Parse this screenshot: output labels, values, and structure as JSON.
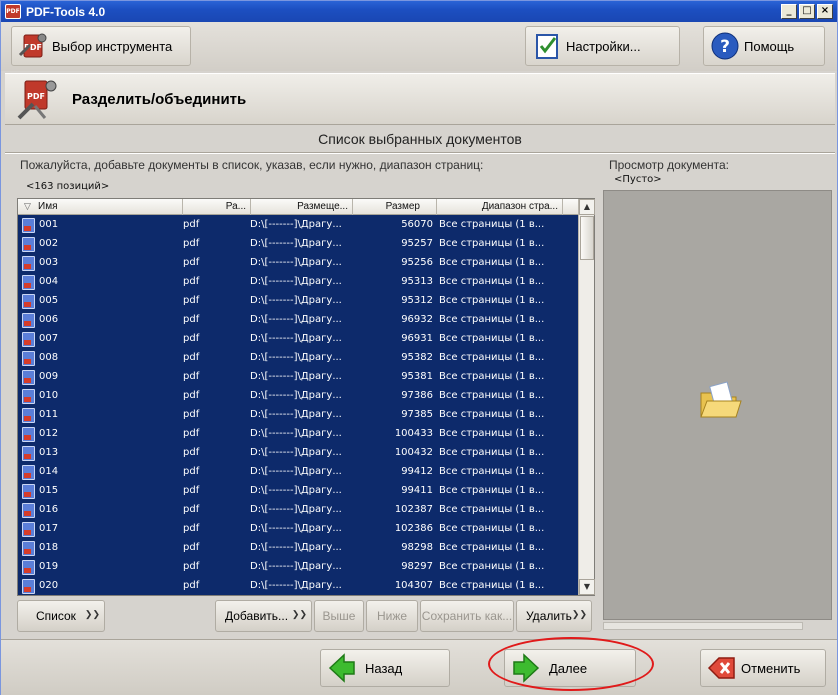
{
  "window": {
    "title": "PDF-Tools 4.0",
    "app_icon_label": "PDF",
    "controls": [
      "_",
      "□",
      "×"
    ]
  },
  "toolbar": {
    "select_tool_label": "Выбор инструмента",
    "settings_label": "Настройки...",
    "help_label": "Помощь",
    "select_tool_icon": "pdf-tools-icon",
    "settings_icon": "settings-checklist-icon",
    "help_icon": "help-question-icon"
  },
  "section": {
    "title": "Разделить/объединить",
    "icon": "split-merge-icon"
  },
  "list": {
    "caption": "Список выбранных документов",
    "hint": "Пожалуйста, добавьте документы в список, указав, если нужно, диапазон страниц:",
    "count": "<163 позиций>",
    "columns": [
      "Имя",
      "Ра...",
      "Размеще...",
      "Размер",
      "Диапазон стра..."
    ],
    "rows": [
      {
        "name": "001",
        "ext": "pdf",
        "location": "D:\\[-------]\\Драгу...",
        "size": "56070",
        "range": "Все страницы (1 в..."
      },
      {
        "name": "002",
        "ext": "pdf",
        "location": "D:\\[-------]\\Драгу...",
        "size": "95257",
        "range": "Все страницы (1 в..."
      },
      {
        "name": "003",
        "ext": "pdf",
        "location": "D:\\[-------]\\Драгу...",
        "size": "95256",
        "range": "Все страницы (1 в..."
      },
      {
        "name": "004",
        "ext": "pdf",
        "location": "D:\\[-------]\\Драгу...",
        "size": "95313",
        "range": "Все страницы (1 в..."
      },
      {
        "name": "005",
        "ext": "pdf",
        "location": "D:\\[-------]\\Драгу...",
        "size": "95312",
        "range": "Все страницы (1 в..."
      },
      {
        "name": "006",
        "ext": "pdf",
        "location": "D:\\[-------]\\Драгу...",
        "size": "96932",
        "range": "Все страницы (1 в..."
      },
      {
        "name": "007",
        "ext": "pdf",
        "location": "D:\\[-------]\\Драгу...",
        "size": "96931",
        "range": "Все страницы (1 в..."
      },
      {
        "name": "008",
        "ext": "pdf",
        "location": "D:\\[-------]\\Драгу...",
        "size": "95382",
        "range": "Все страницы (1 в..."
      },
      {
        "name": "009",
        "ext": "pdf",
        "location": "D:\\[-------]\\Драгу...",
        "size": "95381",
        "range": "Все страницы (1 в..."
      },
      {
        "name": "010",
        "ext": "pdf",
        "location": "D:\\[-------]\\Драгу...",
        "size": "97386",
        "range": "Все страницы (1 в..."
      },
      {
        "name": "011",
        "ext": "pdf",
        "location": "D:\\[-------]\\Драгу...",
        "size": "97385",
        "range": "Все страницы (1 в..."
      },
      {
        "name": "012",
        "ext": "pdf",
        "location": "D:\\[-------]\\Драгу...",
        "size": "100433",
        "range": "Все страницы (1 в..."
      },
      {
        "name": "013",
        "ext": "pdf",
        "location": "D:\\[-------]\\Драгу...",
        "size": "100432",
        "range": "Все страницы (1 в..."
      },
      {
        "name": "014",
        "ext": "pdf",
        "location": "D:\\[-------]\\Драгу...",
        "size": "99412",
        "range": "Все страницы (1 в..."
      },
      {
        "name": "015",
        "ext": "pdf",
        "location": "D:\\[-------]\\Драгу...",
        "size": "99411",
        "range": "Все страницы (1 в..."
      },
      {
        "name": "016",
        "ext": "pdf",
        "location": "D:\\[-------]\\Драгу...",
        "size": "102387",
        "range": "Все страницы (1 в..."
      },
      {
        "name": "017",
        "ext": "pdf",
        "location": "D:\\[-------]\\Драгу...",
        "size": "102386",
        "range": "Все страницы (1 в..."
      },
      {
        "name": "018",
        "ext": "pdf",
        "location": "D:\\[-------]\\Драгу...",
        "size": "98298",
        "range": "Все страницы (1 в..."
      },
      {
        "name": "019",
        "ext": "pdf",
        "location": "D:\\[-------]\\Драгу...",
        "size": "98297",
        "range": "Все страницы (1 в..."
      },
      {
        "name": "020",
        "ext": "pdf",
        "location": "D:\\[-------]\\Драгу...",
        "size": "104307",
        "range": "Все страницы (1 в..."
      }
    ],
    "row_icon": "pdf-file-icon",
    "selection_color": "#0d2a6b"
  },
  "list_buttons": {
    "list": "Список",
    "add": "Добавить...",
    "up": "Выше",
    "down": "Ниже",
    "save_as": "Сохранить как...",
    "delete": "Удалить"
  },
  "preview": {
    "label": "Просмотр документа:",
    "empty": "<Пусто>",
    "icon": "open-folder-icon"
  },
  "nav": {
    "back_label": "Назад",
    "next_label": "Далее",
    "cancel_label": "Отменить",
    "back_icon": "arrow-left-icon",
    "next_icon": "arrow-right-icon",
    "cancel_icon": "cancel-x-icon",
    "highlight_color": "#e01a1a"
  }
}
